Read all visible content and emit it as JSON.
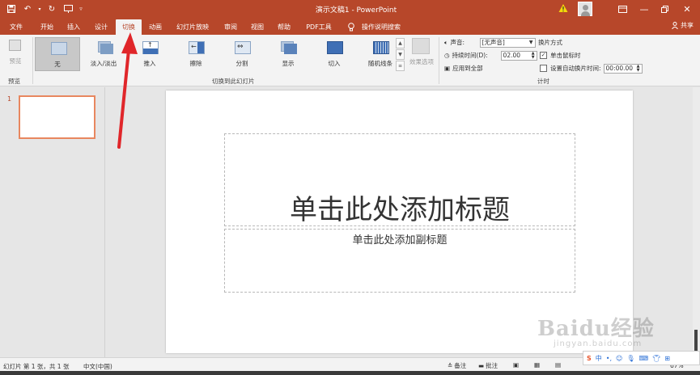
{
  "titlebar": {
    "document_title": "演示文稿1 - PowerPoint",
    "qat_icons": [
      "save-icon",
      "undo-icon",
      "redo-icon",
      "present-icon",
      "customize-icon"
    ],
    "window_controls": [
      "ribbon-display-icon",
      "minimize-icon",
      "restore-icon",
      "close-icon"
    ]
  },
  "tabs": [
    {
      "label": "文件",
      "active": false
    },
    {
      "label": "开始",
      "active": false
    },
    {
      "label": "插入",
      "active": false
    },
    {
      "label": "设计",
      "active": false
    },
    {
      "label": "切换",
      "active": true
    },
    {
      "label": "动画",
      "active": false
    },
    {
      "label": "幻灯片放映",
      "active": false
    },
    {
      "label": "审阅",
      "active": false
    },
    {
      "label": "视图",
      "active": false
    },
    {
      "label": "帮助",
      "active": false
    },
    {
      "label": "PDF工具",
      "active": false
    },
    {
      "label": "操作说明搜索",
      "active": false
    }
  ],
  "share_label": "共享",
  "ribbon": {
    "preview": {
      "button_label": "预览",
      "group_label": "预览"
    },
    "transitions": {
      "group_label": "切换到此幻灯片",
      "items": [
        {
          "label": "无",
          "selected": true
        },
        {
          "label": "淡入/淡出",
          "selected": false
        },
        {
          "label": "推入",
          "selected": false
        },
        {
          "label": "擦除",
          "selected": false
        },
        {
          "label": "分割",
          "selected": false
        },
        {
          "label": "显示",
          "selected": false
        },
        {
          "label": "切入",
          "selected": false
        },
        {
          "label": "随机线条",
          "selected": false
        }
      ],
      "effect_options_label": "效果选项"
    },
    "timing": {
      "group_label": "计时",
      "sound_label": "声音:",
      "sound_value": "[无声音]",
      "duration_label": "持续时间(D):",
      "duration_value": "02.00",
      "apply_all_label": "应用到全部",
      "advance_title": "换片方式",
      "on_click_label": "单击鼠标时",
      "on_click_checked": true,
      "after_label": "设置自动换片时间:",
      "after_checked": false,
      "after_value": "00:00.00"
    }
  },
  "thumbnail_pane": {
    "slide_number": "1"
  },
  "slide": {
    "title_placeholder": "单击此处添加标题",
    "subtitle_placeholder": "单击此处添加副标题"
  },
  "statusbar": {
    "slide_info": "幻灯片 第 1 张，共 1 张",
    "language": "中文(中国)",
    "notes_label": "备注",
    "comments_label": "批注",
    "zoom": "67%"
  },
  "ime": {
    "mode_label": "中"
  },
  "watermark": {
    "main": "Baidu经验",
    "sub": "jingyan.baidu.com"
  },
  "colors": {
    "accent": "#b7472a",
    "selection": "#c8c8c8",
    "thumb_border": "#e8875f",
    "arrow": "#e0262a"
  }
}
